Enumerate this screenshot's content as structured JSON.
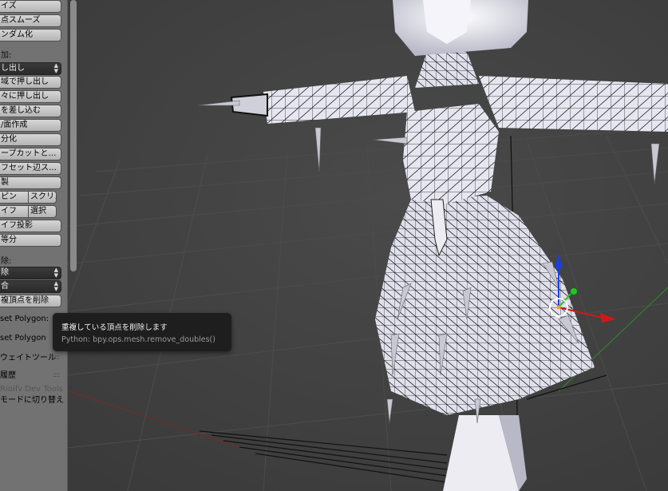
{
  "toolshelf": {
    "btn_size": "イズ",
    "btn_vertex_smooth": "点スムーズ",
    "btn_randomize": "ンダム化",
    "label_add": "加:",
    "select_extrude": "し出し",
    "btn_extrude_region": "域で押し出し",
    "btn_extrude_individual": "々に押し出し",
    "btn_inset": "を差し込む",
    "btn_make_edge_face": "/面作成",
    "btn_subdivide": "分化",
    "btn_loop_cut": "ープカットと…",
    "btn_offset_edge": "フセット辺ス…",
    "btn_duplicate": "製",
    "btn_spin": "ピン",
    "btn_screw": "スクリュ",
    "btn_knife": "イフ",
    "btn_select": "選択",
    "btn_knife_project": "イフ投影",
    "btn_bisect": "等分",
    "label_remove": "除:",
    "select_delete": "除",
    "select_merge": "合",
    "btn_remove_doubles": "複頂点を削除",
    "row_set_polygon_1": "set Polygon:",
    "row_set_polygon_2": "set Polygon",
    "row_weight_tools": "ウェイトツール",
    "row_history": "履歴",
    "row_rigify": "Rigify Dev Tools",
    "row_switch_mode": "モードに切り替え"
  },
  "tooltip": {
    "title": "重複している頂点を削除します",
    "python": "Python: bpy.ops.mesh.remove_doubles()"
  },
  "viewport": {
    "background": "#3d3d3d",
    "mesh_color": "#e4e4f0",
    "wire_color": "#101010",
    "axis_x_color": "#d01818",
    "axis_y_color": "#1ec81e",
    "axis_z_color": "#1a3fe0",
    "widget_names": [
      "axis-z-arrow-icon",
      "axis-x-arrow-icon",
      "axis-y-handle-icon",
      "pivot-circle-icon"
    ]
  }
}
